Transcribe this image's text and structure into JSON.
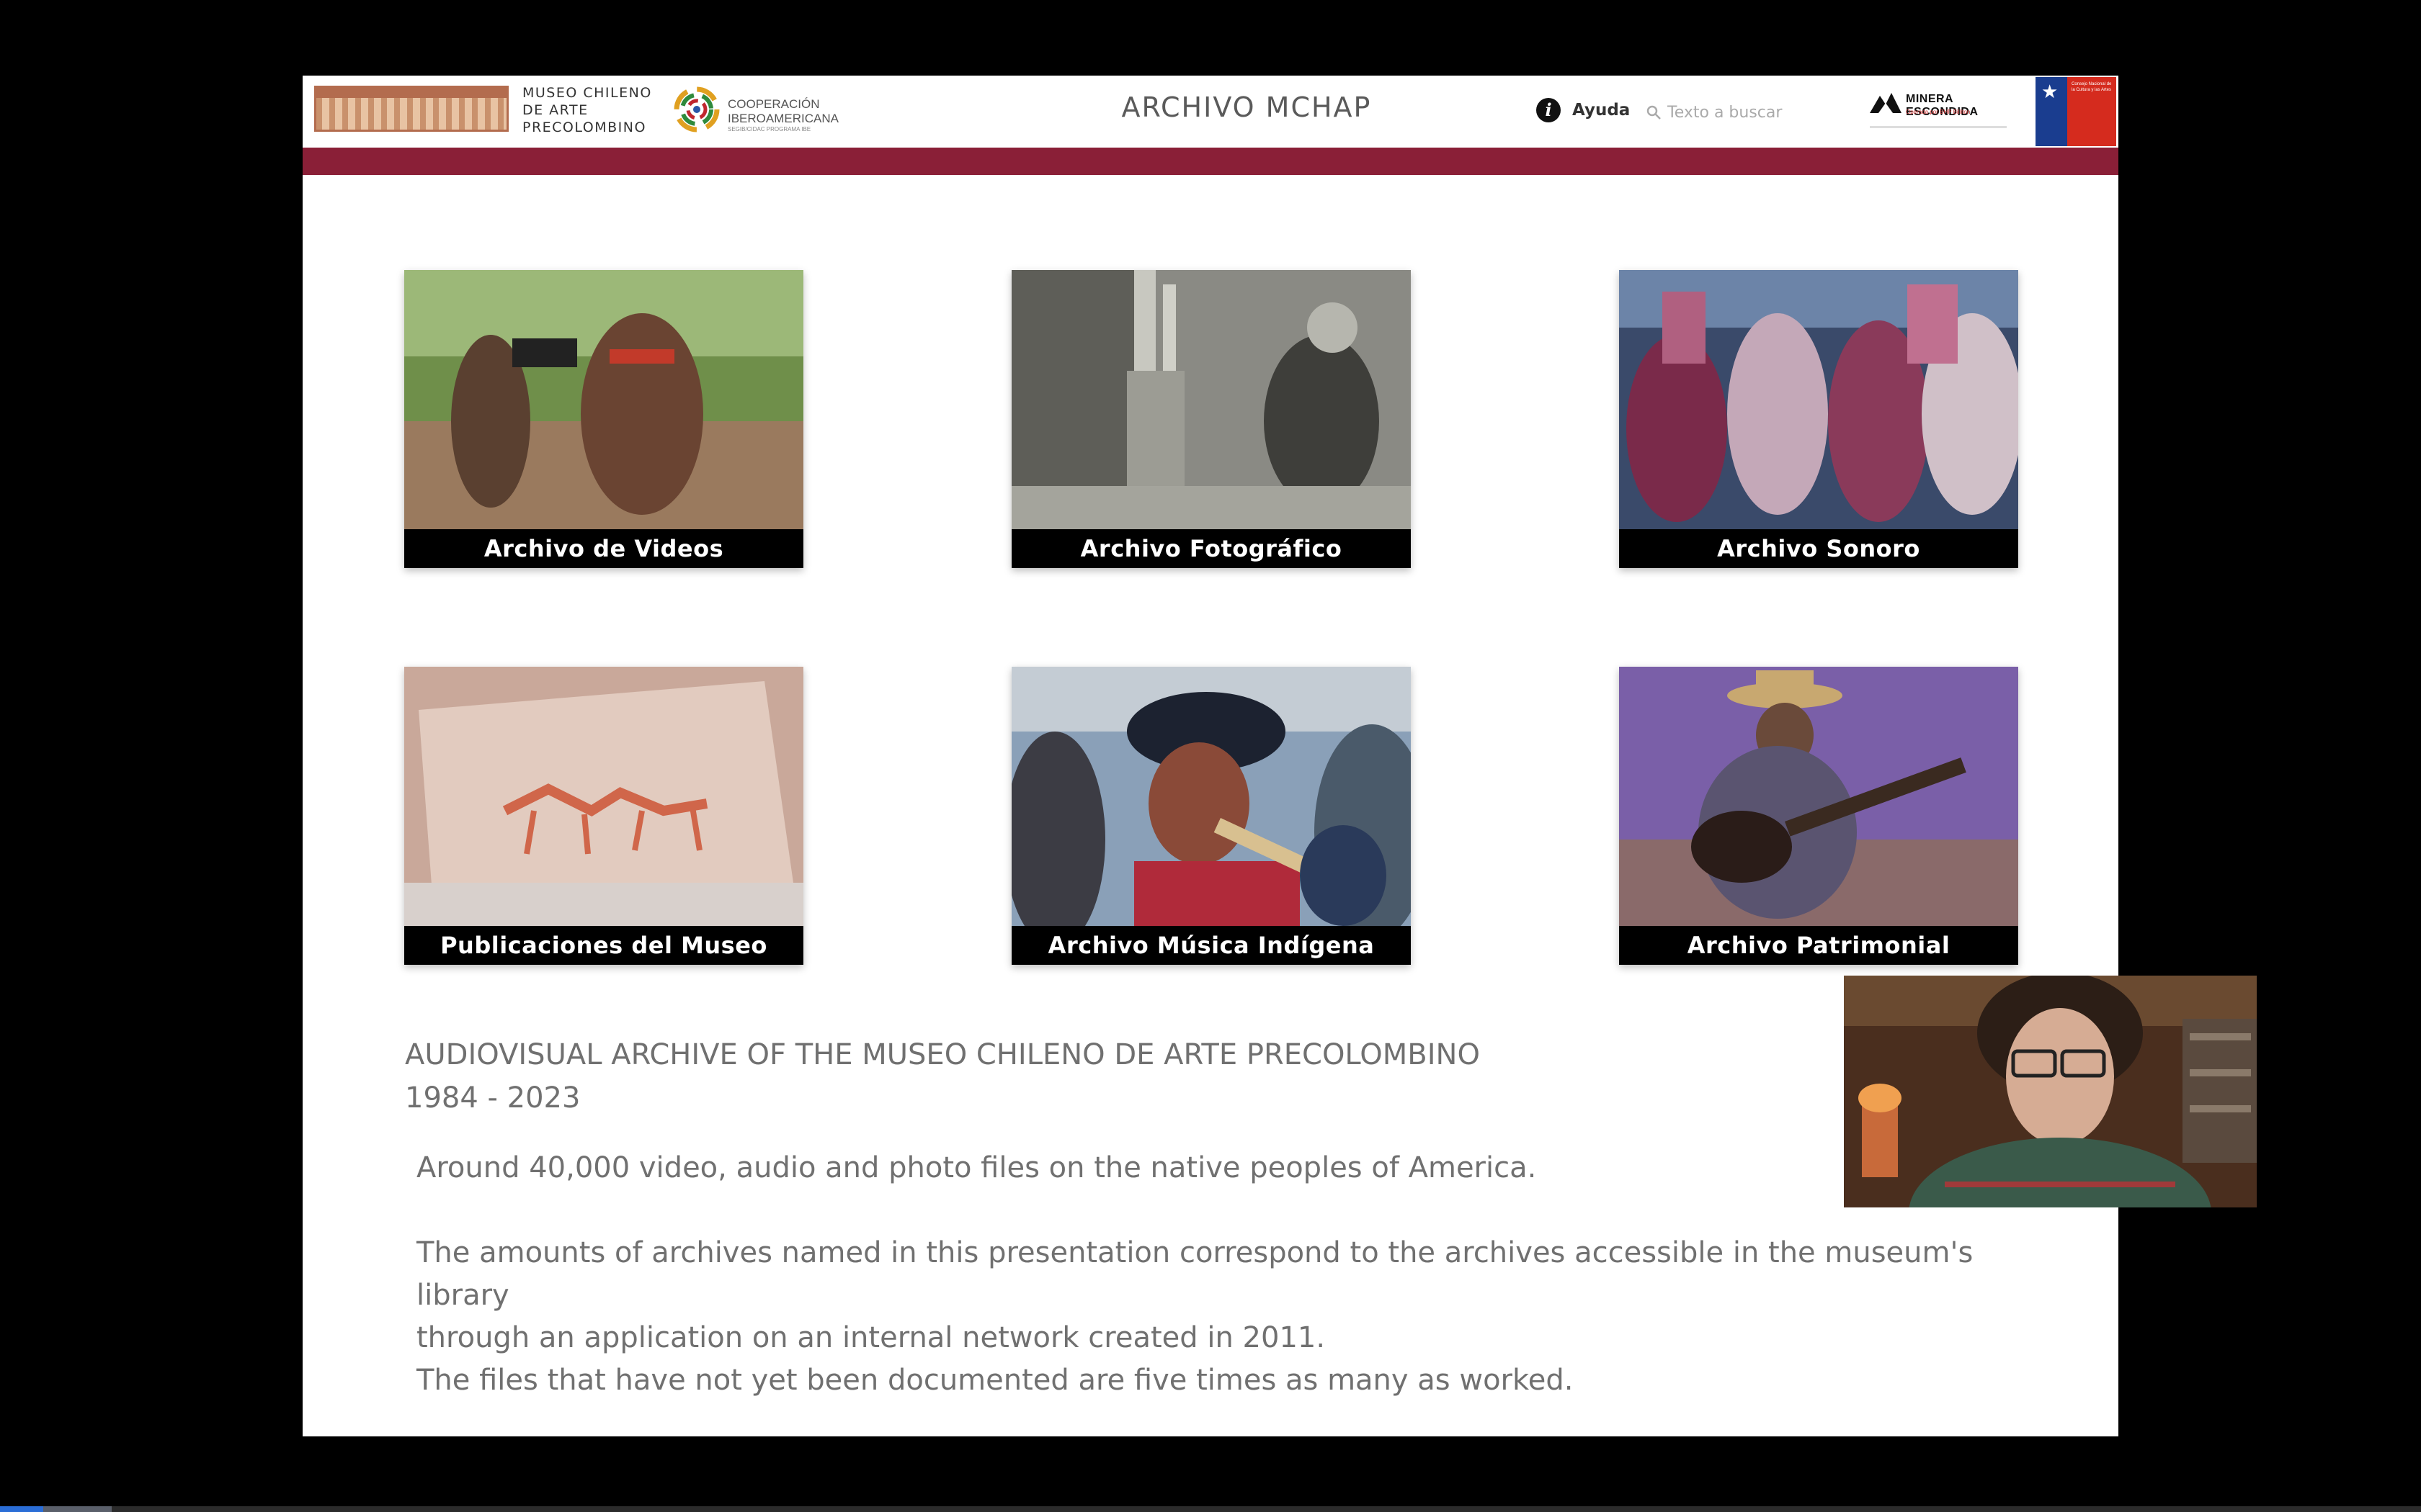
{
  "header": {
    "museum_name_lines": [
      "MUSEO CHILENO",
      "DE ARTE",
      "PRECOLOMBINO"
    ],
    "coop_text_lines": [
      "COOPERACIÓN",
      "IBEROAMERICANA"
    ],
    "coop_subtext": "SEGIB/CIDAC PROGRAMA IBE",
    "app_title": "ARCHIVO MCHAP",
    "help_label": "Ayuda",
    "search_placeholder": "Texto a buscar",
    "sponsor_name": "MINERA ESCONDIDA",
    "sponsor_sub": "Operada por BHP Billiton",
    "gov_text": "Consejo Nacional de la Cultura y las Artes",
    "colors": {
      "maroon_bar": "#8a1f37",
      "title": "#5a5a5a"
    }
  },
  "tiles": [
    {
      "label": "Archivo de Videos",
      "image": "filmmakers-in-forest"
    },
    {
      "label": "Archivo Fotográfico",
      "image": "weaver-at-loom-bw"
    },
    {
      "label": "Archivo Sonoro",
      "image": "festival-dancers"
    },
    {
      "label": "Publicaciones del Museo",
      "image": "rock-art-llamas"
    },
    {
      "label": "Archivo Música Indígena",
      "image": "flute-player"
    },
    {
      "label": "Archivo Patrimonial",
      "image": "guitar-player"
    }
  ],
  "content": {
    "heading_line1": "AUDIOVISUAL ARCHIVE OF THE MUSEO CHILENO DE ARTE PRECOLOMBINO",
    "heading_line2": "1984 - 2023",
    "paragraph1": "Around 40,000 video, audio and photo files on the native peoples of America.",
    "paragraph2_line1": "The amounts of archives named in this presentation correspond to the archives accessible in the museum's library",
    "paragraph2_line2": "through an application on an internal network created in 2011.",
    "paragraph3": "The files that have not yet been documented are five times as many as worked."
  },
  "webcam": {
    "image": "presenter-webcam"
  },
  "player": {
    "progress": 0.018,
    "buffered": 0.046,
    "accent": "#2a6dd6"
  }
}
